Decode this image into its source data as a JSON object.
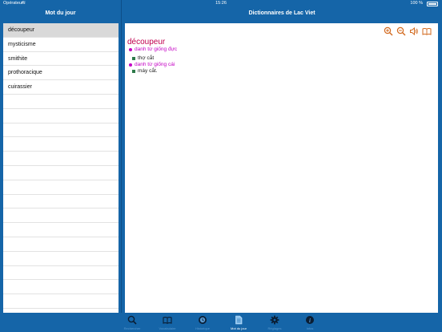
{
  "status_bar": {
    "carrier": "Opérateur",
    "time": "15:26",
    "battery_percent": "100 %"
  },
  "left_panel": {
    "title": "Mot du jour",
    "words": [
      "découpeur",
      "mysticisme",
      "smithite",
      "prothoracique",
      "cuirassier"
    ],
    "selected_index": 0
  },
  "right_panel": {
    "title": "Dictionnaires de Lac Viet",
    "toolbar": [
      "zoom-in-icon",
      "zoom-out-icon",
      "speaker-icon",
      "book-icon"
    ],
    "entry": {
      "headword": "découpeur",
      "senses": [
        {
          "pos": "danh từ giống đực",
          "definition": "thợ cắt"
        },
        {
          "pos": "danh từ giống cái",
          "definition": "máy cắt."
        }
      ]
    }
  },
  "tab_bar": {
    "tabs": [
      {
        "label": "Rechercher",
        "icon": "search-icon"
      },
      {
        "label": "Vocabulaire",
        "icon": "book-icon"
      },
      {
        "label": "Historique",
        "icon": "history-icon"
      },
      {
        "label": "Mot du jour",
        "icon": "document-icon"
      },
      {
        "label": "Réglages",
        "icon": "gear-icon"
      },
      {
        "label": "Infos",
        "icon": "info-icon"
      }
    ],
    "active_index": 3
  },
  "colors": {
    "brand_blue": "#1565a8",
    "headword": "#c0004e",
    "part_of_speech": "#c400c4",
    "toolbar_icons": "#d2691e"
  }
}
